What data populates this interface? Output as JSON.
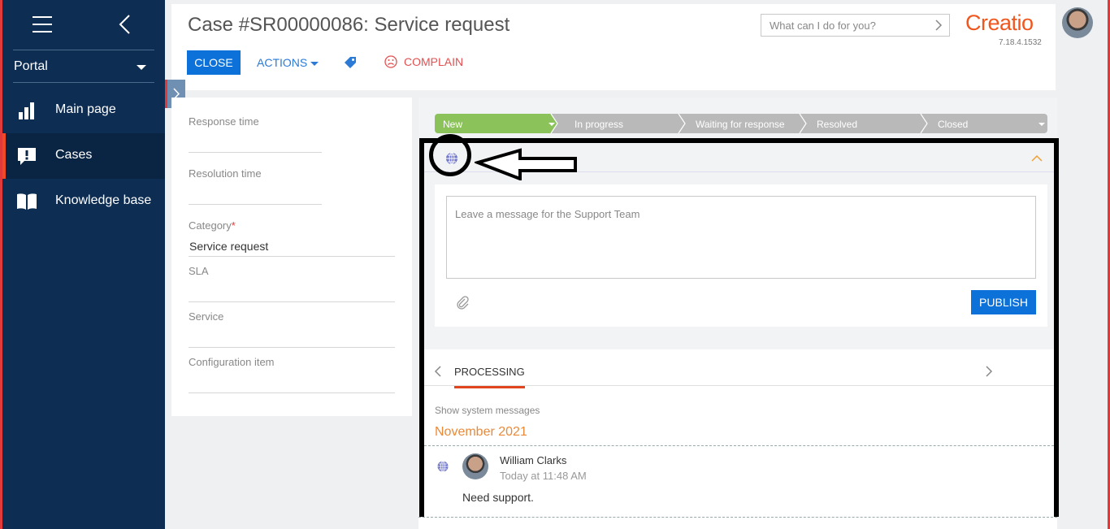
{
  "sidebar": {
    "portal_label": "Portal",
    "items": [
      {
        "label": "Main page",
        "icon": "bar-chart-icon"
      },
      {
        "label": "Cases",
        "icon": "alert-bubble-icon",
        "active": true
      },
      {
        "label": "Knowledge base",
        "icon": "book-icon"
      }
    ]
  },
  "header": {
    "title": "Case #SR00000086: Service request",
    "close_label": "CLOSE",
    "actions_label": "ACTIONS",
    "complain_label": "COMPLAIN",
    "search_placeholder": "What can I do for you?",
    "logo": "Creatio",
    "version": "7.18.4.1532"
  },
  "details": {
    "response_time_label": "Response time",
    "resolution_time_label": "Resolution time",
    "category_label": "Category",
    "category_required_mark": "*",
    "category_value": "Service request",
    "sla_label": "SLA",
    "service_label": "Service",
    "config_item_label": "Configuration item"
  },
  "stages": [
    "New",
    "In progress",
    "Waiting for response",
    "Resolved",
    "Closed"
  ],
  "composer": {
    "placeholder": "Leave a message for the Support Team",
    "publish_label": "PUBLISH"
  },
  "feed": {
    "tab_label": "PROCESSING",
    "show_system_messages": "Show system messages",
    "month": "November 2021",
    "post": {
      "author": "William Clarks",
      "time": "Today at 11:48 AM",
      "text": "Need support."
    }
  },
  "colors": {
    "sidebar": "#0d2d53",
    "accent_blue": "#0c72d9",
    "stage_active": "#8bc35a",
    "stage_inactive": "#b9b9b9",
    "brand": "#f0571f"
  }
}
